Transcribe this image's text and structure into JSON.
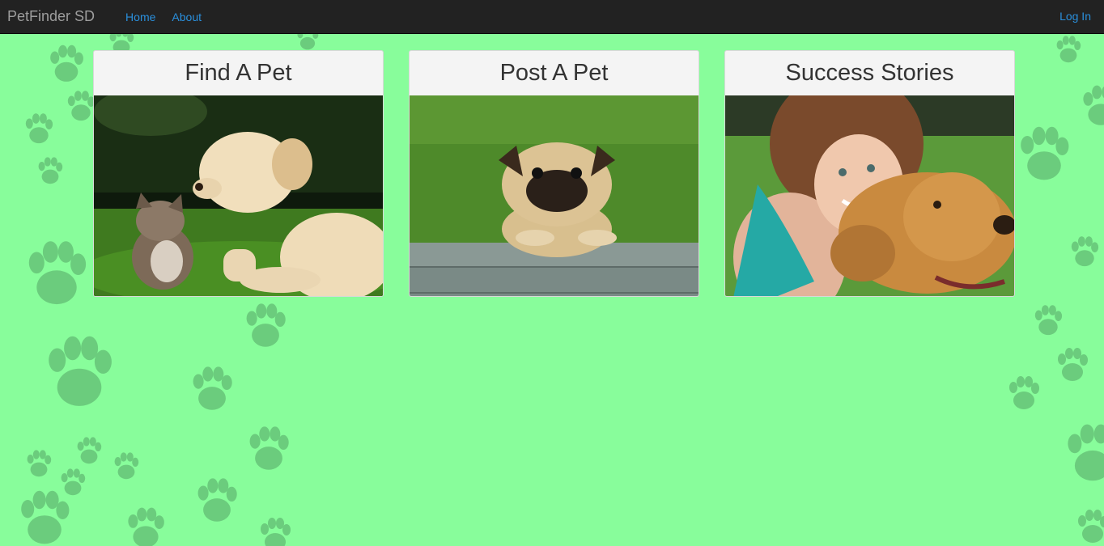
{
  "navbar": {
    "brand": "PetFinder SD",
    "links": [
      "Home",
      "About"
    ],
    "login": "Log In"
  },
  "cards": [
    {
      "title": "Find A Pet"
    },
    {
      "title": "Post A Pet"
    },
    {
      "title": "Success Stories"
    }
  ],
  "colors": {
    "page_background": "#88fd9b",
    "navbar_background": "#222222",
    "link": "#2a8fdc",
    "paw": "#4e9a5e"
  }
}
